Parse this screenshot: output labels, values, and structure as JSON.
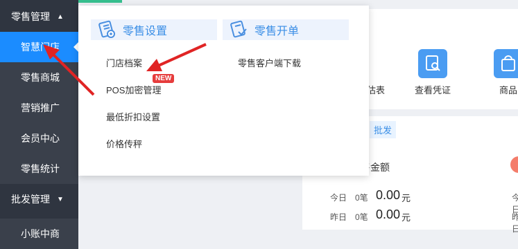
{
  "sidebar": {
    "retail_group": "零售管理",
    "items": [
      "智慧门店",
      "零售商城",
      "营销推广",
      "会员中心",
      "零售统计"
    ],
    "wholesale_group": "批发管理",
    "partial_item": "小账中商"
  },
  "popup": {
    "retail_settings": {
      "title": "零售设置",
      "links": [
        "门店档案",
        "POS加密管理",
        "最低折扣设置",
        "价格传秤"
      ],
      "new_badge": "NEW"
    },
    "retail_billing": {
      "title": "零售开单",
      "links": [
        "零售客户端下载"
      ]
    }
  },
  "background": {
    "shortcuts": [
      "估表",
      "查看凭证",
      "商品"
    ],
    "tab_wholesale": "批发",
    "sales_amount_label": "售金额",
    "stats": {
      "today_label": "今日",
      "today_count": "0笔",
      "today_amount": "0.00",
      "yesterday_label": "昨日",
      "yesterday_count": "0笔",
      "yesterday_amount": "0.00",
      "currency": "元"
    }
  },
  "colors": {
    "sidebar_bg": "#2f3540",
    "active_blue": "#1b8cff",
    "header_blue": "#3a8ee6",
    "arrow_red": "#e02424"
  }
}
